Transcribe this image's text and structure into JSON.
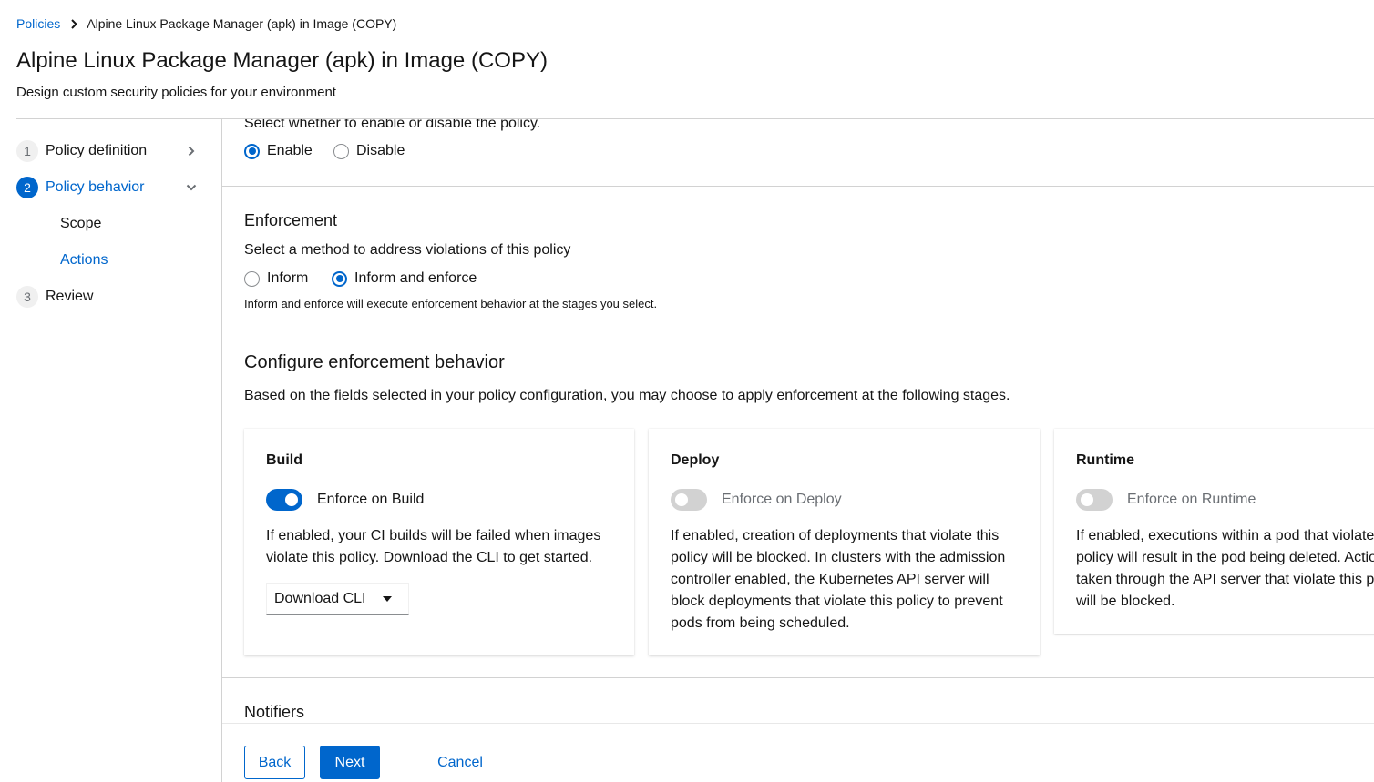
{
  "breadcrumb": {
    "root": "Policies",
    "current": "Alpine Linux Package Manager (apk) in Image (COPY)"
  },
  "header": {
    "title": "Alpine Linux Package Manager (apk) in Image (COPY)",
    "description": "Design custom security policies for your environment"
  },
  "wizard_nav": {
    "steps": [
      {
        "number": "1",
        "label": "Policy definition",
        "icon": "chevron-right-icon"
      },
      {
        "number": "2",
        "label": "Policy behavior",
        "icon": "chevron-down-icon",
        "active": true
      },
      {
        "number": "3",
        "label": "Review"
      }
    ],
    "substeps": [
      {
        "label": "Scope"
      },
      {
        "label": "Actions",
        "active": true
      }
    ]
  },
  "status_section": {
    "description": "Select whether to enable or disable the policy.",
    "options": [
      {
        "label": "Enable",
        "checked": true
      },
      {
        "label": "Disable",
        "checked": false
      }
    ]
  },
  "enforcement": {
    "title": "Enforcement",
    "description": "Select a method to address violations of this policy",
    "options": [
      {
        "label": "Inform",
        "checked": false
      },
      {
        "label": "Inform and enforce",
        "checked": true
      }
    ],
    "helper": "Inform and enforce will execute enforcement behavior at the stages you select."
  },
  "configure": {
    "title": "Configure enforcement behavior",
    "description": "Based on the fields selected in your policy configuration, you may choose to apply enforcement at the following stages.",
    "cards": [
      {
        "title": "Build",
        "switch_label": "Enforce on Build",
        "enabled": true,
        "lines": [
          "If enabled, your CI builds will be failed when images",
          "violate this policy. Download the CLI to get started."
        ],
        "dropdown": "Download CLI"
      },
      {
        "title": "Deploy",
        "switch_label": "Enforce on Deploy",
        "enabled": false,
        "lines": [
          "If enabled, creation of deployments that violate this",
          "policy will be blocked. In clusters with the admission",
          "controller enabled, the Kubernetes API server will",
          "block deployments that violate this policy to prevent",
          "pods from being scheduled."
        ]
      },
      {
        "title": "Runtime",
        "switch_label": "Enforce on Runtime",
        "enabled": false,
        "lines": [
          "If enabled, executions within a pod that violate this",
          "policy will result in the pod being deleted. Actions",
          "taken through the API server that violate this policy",
          "will be blocked."
        ]
      }
    ]
  },
  "notifiers": {
    "title": "Notifiers"
  },
  "footer": {
    "back": "Back",
    "next": "Next",
    "cancel": "Cancel"
  },
  "colors": {
    "accent": "#0066cc",
    "border": "#d2d2d2",
    "disabled_switch": "#d2d2d2"
  }
}
